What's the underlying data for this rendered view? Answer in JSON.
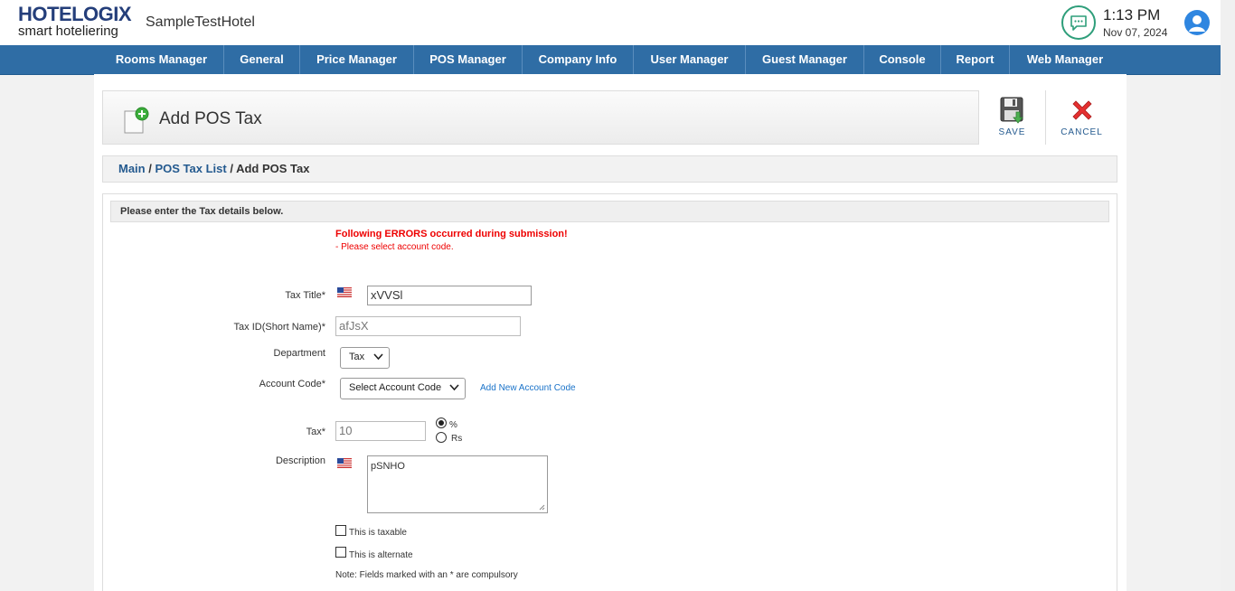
{
  "header": {
    "logo_main": "HOTELOGIX",
    "logo_sub": "smart hoteliering",
    "hotel_name": "SampleTestHotel",
    "time": "1:13 PM",
    "date": "Nov 07, 2024"
  },
  "nav": {
    "items": [
      "Rooms Manager",
      "General",
      "Price Manager",
      "POS Manager",
      "Company Info",
      "User Manager",
      "Guest Manager",
      "Console",
      "Report",
      "Web Manager"
    ]
  },
  "page": {
    "title": "Add POS Tax",
    "save_label": "SAVE",
    "cancel_label": "CANCEL"
  },
  "breadcrumb": {
    "main": "Main",
    "sep1": " / ",
    "list": "POS Tax List",
    "sep2": " / ",
    "current": "Add POS Tax"
  },
  "form": {
    "heading": "Please enter the Tax details below.",
    "error_title": "Following ERRORS occurred during submission!",
    "error_item": "- Please select account code.",
    "tax_title_label": "Tax Title*",
    "tax_title_value": "xVVSl",
    "tax_id_label": "Tax ID(Short Name)*",
    "tax_id_value": "afJsX",
    "department_label": "Department",
    "department_value": "Tax",
    "account_code_label": "Account Code*",
    "account_code_value": "Select Account Code",
    "add_account_code": "Add New Account Code",
    "tax_label": "Tax*",
    "tax_value": "10",
    "percent_label": "%",
    "rs_label": "Rs",
    "description_label": "Description",
    "description_value": "pSNHO",
    "taxable_label": "This is taxable",
    "alternate_label": "This is alternate",
    "note": "Note: Fields marked with an * are compulsory"
  },
  "colors": {
    "nav_bg": "#2f6da5",
    "error": "#ee0000",
    "link": "#245a8f"
  }
}
